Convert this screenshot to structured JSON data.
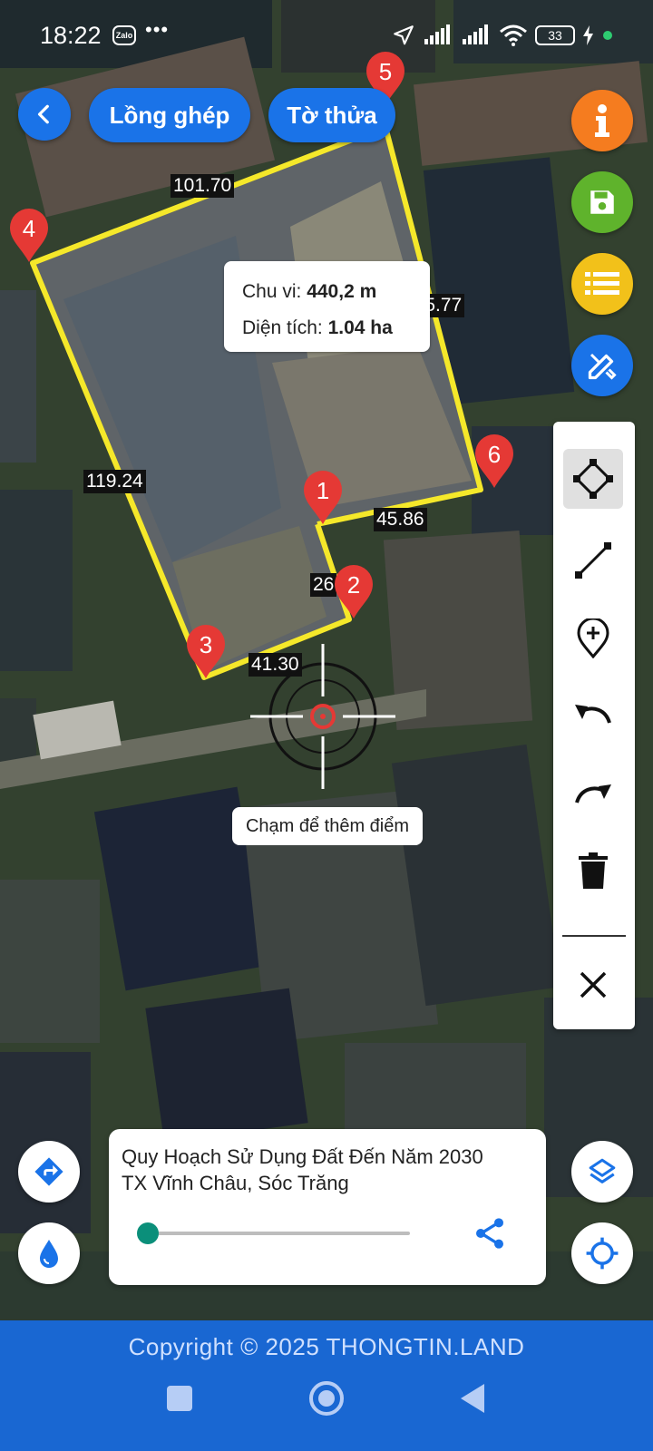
{
  "status_bar": {
    "time": "18:22",
    "notification_icon": "Zalo",
    "more": "•••",
    "battery": "33"
  },
  "header": {
    "back_icon": "chevron-left-icon",
    "tab_lonn_ghep": "Lồng ghép",
    "tab_to_thua": "Tờ thửa"
  },
  "side_buttons": {
    "info": {
      "icon": "info-icon",
      "color": "#f57c1f"
    },
    "save": {
      "icon": "save-icon",
      "color": "#5fb32c"
    },
    "list": {
      "icon": "list-icon",
      "color": "#f2c11a"
    },
    "edit": {
      "icon": "edit-ruler-icon",
      "color": "#1a73e8"
    }
  },
  "measurement": {
    "perimeter_label": "Chu vi:",
    "perimeter_value": "440,2 m",
    "area_label": "Diện tích:",
    "area_value": "1.04 ha"
  },
  "segments": [
    {
      "id": "s45",
      "label": "101.70"
    },
    {
      "id": "s56",
      "label": "165.77"
    },
    {
      "id": "s34",
      "label": "119.24"
    },
    {
      "id": "s61",
      "label": "45.86"
    },
    {
      "id": "s12",
      "label": "26"
    },
    {
      "id": "s23",
      "label": "41.30"
    }
  ],
  "markers": [
    "1",
    "2",
    "3",
    "4",
    "5",
    "6"
  ],
  "crosshair_hint": "Chạm để thêm điểm",
  "toolbar": [
    {
      "name": "polygon-tool",
      "icon": "polygon-icon",
      "active": true
    },
    {
      "name": "line-tool",
      "icon": "line-icon",
      "active": false
    },
    {
      "name": "add-point-tool",
      "icon": "add-location-icon",
      "active": false
    },
    {
      "name": "undo-tool",
      "icon": "undo-icon",
      "active": false
    },
    {
      "name": "redo-tool",
      "icon": "redo-icon",
      "active": false
    },
    {
      "name": "delete-tool",
      "icon": "trash-icon",
      "active": false
    },
    {
      "name": "close-tool",
      "icon": "close-icon",
      "active": false
    }
  ],
  "bottom_left": {
    "directions_icon": "directions-icon",
    "water_icon": "water-drop-icon"
  },
  "bottom_right": {
    "layers_icon": "layers-icon",
    "locate_icon": "my-location-icon"
  },
  "plan_panel": {
    "title_line1": "Quy Hoạch Sử Dụng Đất Đến Năm 2030",
    "title_line2": "TX Vĩnh Châu, Sóc Trăng",
    "opacity_slider_value": 0,
    "share_icon": "share-icon"
  },
  "footer": {
    "copyright": "Copyright © 2025 THONGTIN.LAND"
  },
  "nav_bar": [
    "recent-apps",
    "home",
    "back"
  ]
}
